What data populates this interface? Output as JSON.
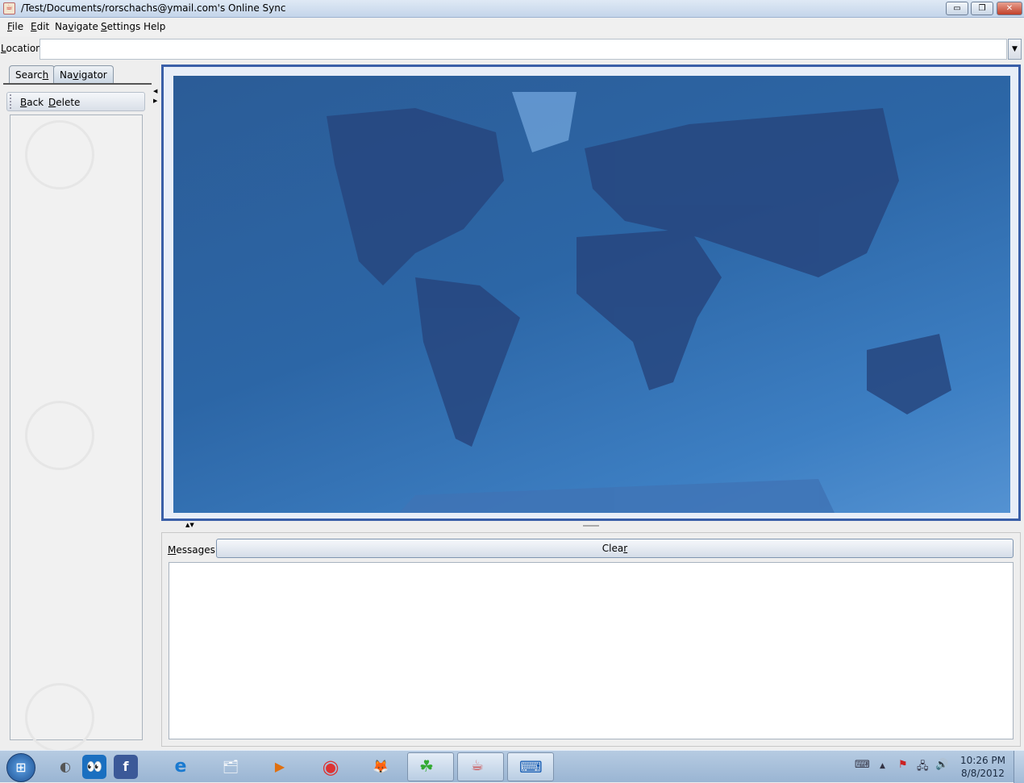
{
  "window": {
    "title": "/Test/Documents/rorschachs@ymail.com's Online Sync",
    "minimize": "▭",
    "restore": "❐",
    "close": "✕"
  },
  "menu": [
    {
      "u": "F",
      "rest": "ile"
    },
    {
      "u": "E",
      "rest": "dit"
    },
    {
      "pre": "Na",
      "u": "v",
      "rest": "igate"
    },
    {
      "u": "S",
      "rest": "ettings"
    },
    {
      "pre": "Help",
      "u": "",
      "rest": ""
    }
  ],
  "location": {
    "label_u": "L",
    "label_rest": "ocation",
    "value": "",
    "dropdown": "▼"
  },
  "tabs": {
    "search_pre": "Searc",
    "search_u": "h",
    "navigator_pre": "Na",
    "navigator_u": "v",
    "navigator_rest": "igator"
  },
  "toolbar": {
    "back_u": "B",
    "back_rest": "ack",
    "delete_u": "D",
    "delete_rest": "elete"
  },
  "messages": {
    "label_u": "M",
    "label_rest": "essages",
    "clear_pre": "Clea",
    "clear_u": "r",
    "content": ""
  },
  "taskbar": {
    "start": "⊞",
    "icons": [
      "◐",
      "👀",
      "f",
      "e",
      "🗂",
      "▶",
      "◉",
      "🦊",
      "☘",
      "☕",
      "⌨"
    ]
  },
  "tray": {
    "time": "10:26 PM",
    "date": "8/8/2012",
    "keyboard": "⌨",
    "arrow": "▲",
    "flag": "⚑",
    "network": "🖧",
    "volume": "🔊"
  }
}
